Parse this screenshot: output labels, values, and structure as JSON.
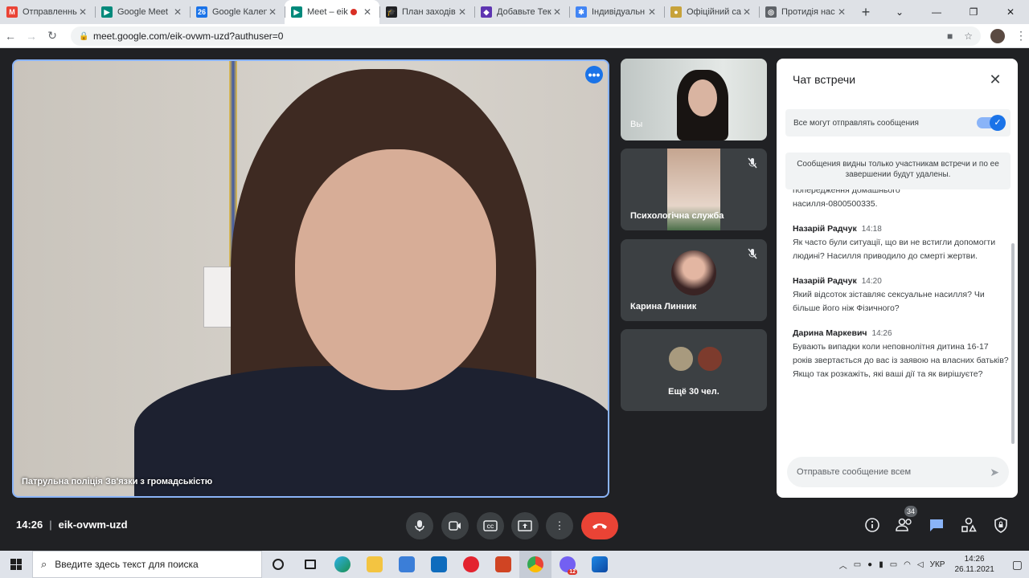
{
  "browser": {
    "tabs": [
      {
        "title": "Отправленны",
        "fav": "M",
        "color": "#ea4335"
      },
      {
        "title": "Google Meet",
        "fav": "▶",
        "color": "#00897b"
      },
      {
        "title": "Google Калеn",
        "fav": "26",
        "color": "#1a73e8"
      },
      {
        "title": "Meet – eik",
        "fav": "▶",
        "color": "#00897b",
        "active": true
      },
      {
        "title": "План заходів",
        "fav": "🎓",
        "color": "#202124"
      },
      {
        "title": "Добавьте Тек",
        "fav": "◆",
        "color": "#5e35b1"
      },
      {
        "title": "Індивідуальн",
        "fav": "✱",
        "color": "#4285f4"
      },
      {
        "title": "Офіційний са",
        "fav": "●",
        "color": "#c7a23a"
      },
      {
        "title": "Протидія нас",
        "fav": "◎",
        "color": "#5f6368"
      }
    ],
    "new_tab": "+",
    "url": "meet.google.com/eik-ovwm-uzd?authuser=0"
  },
  "main_video": {
    "label": "Патрульна поліція Зв'язки з громадськістю"
  },
  "tiles": [
    {
      "name": "Вы"
    },
    {
      "name": "Психологічна служба"
    },
    {
      "name": "Карина Линник"
    },
    {
      "name": "Ещё 30 чел."
    }
  ],
  "chat": {
    "title": "Чат встречи",
    "toggle_label": "Все могут отправлять сообщения",
    "notice": "Сообщения видны только участникам встречи и по ее завершении будут удалены.",
    "cut_text_1": "попередження домашнього",
    "cut_text_2": "насилля-0800500335.",
    "messages": [
      {
        "author": "Назарій Радчук",
        "time": "14:18",
        "text": "Як часто були ситуації, що ви не встигли допомогти людині? Насилля приводило до смерті жертви."
      },
      {
        "author": "Назарій Радчук",
        "time": "14:20",
        "text": "Який відсоток зіставляє сексуальне насилля? Чи більше його ніж Фізичного?"
      },
      {
        "author": "Дарина Маркевич",
        "time": "14:26",
        "text": "Бувають випадки коли неповнолітня дитина 16-17 років звертається до вас із заявою на власних батьків? Якщо так розкажіть, які ваші дії та як вирішуєте?"
      }
    ],
    "input_placeholder": "Отправьте сообщение всем"
  },
  "meeting": {
    "time": "14:26",
    "code": "eik-ovwm-uzd",
    "participants_count": "34"
  },
  "taskbar": {
    "search_placeholder": "Введите здесь текст для поиска",
    "language": "УКР",
    "time": "14:26",
    "date": "26.11.2021",
    "viber_badge": "12"
  }
}
